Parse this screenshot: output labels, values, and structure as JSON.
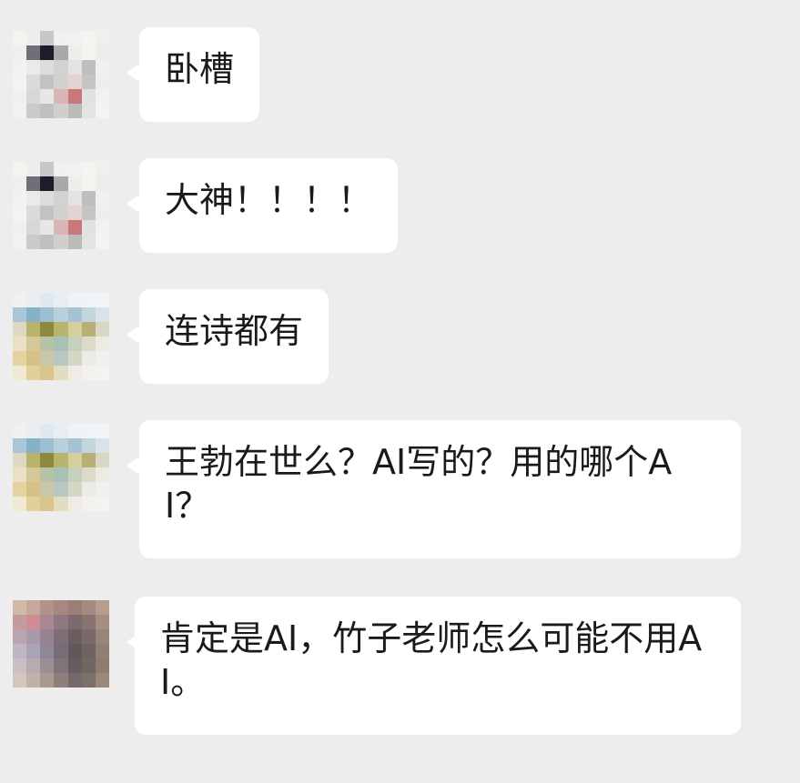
{
  "messages": [
    {
      "text": "卧槽",
      "avatar": "avatar-a"
    },
    {
      "text": "大神！！！！",
      "avatar": "avatar-a"
    },
    {
      "text": "连诗都有",
      "avatar": "avatar-b"
    },
    {
      "text": "王勃在世么？AI写的？用的哪个AI？",
      "avatar": "avatar-b"
    },
    {
      "text": "肯定是AI，竹子老师怎么可能不用AI。",
      "avatar": "avatar-c"
    }
  ],
  "colors": {
    "background": "#ededed",
    "bubble": "#ffffff",
    "text": "#1a1a1a"
  }
}
